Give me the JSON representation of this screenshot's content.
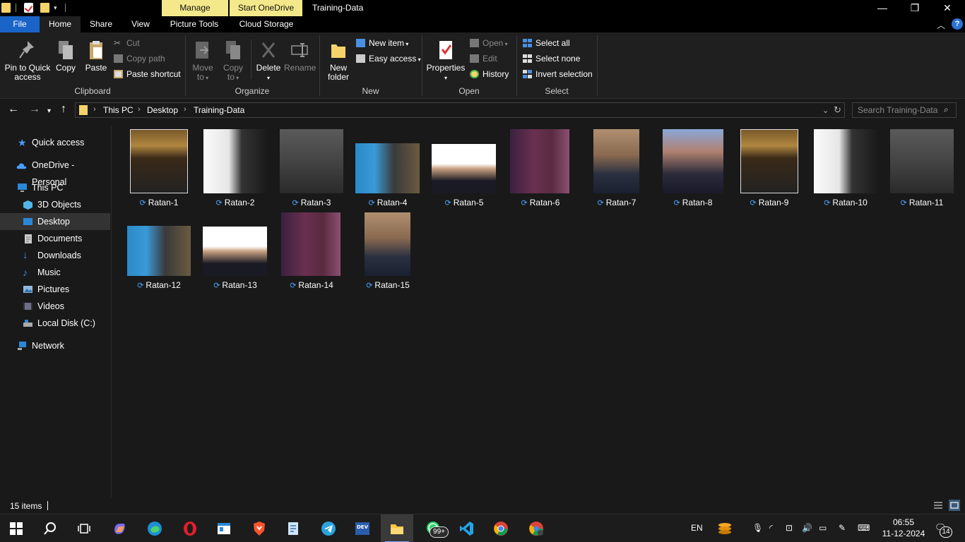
{
  "window": {
    "title": "Training-Data",
    "contextual_tabs": [
      "Manage",
      "Start OneDrive"
    ],
    "controls": {
      "minimize": "—",
      "maximize": "❐",
      "close": "✕"
    }
  },
  "ribbon_tabs": [
    "File",
    "Home",
    "Share",
    "View",
    "Picture Tools",
    "Cloud Storage"
  ],
  "ribbon": {
    "clipboard": {
      "label": "Clipboard",
      "pin": "Pin to Quick access",
      "copy": "Copy",
      "paste": "Paste",
      "cut": "Cut",
      "copy_path": "Copy path",
      "paste_shortcut": "Paste shortcut"
    },
    "organize": {
      "label": "Organize",
      "move_to": "Move to",
      "copy_to": "Copy to",
      "delete": "Delete",
      "rename": "Rename"
    },
    "new": {
      "label": "New",
      "new_folder": "New folder",
      "new_item": "New item",
      "easy_access": "Easy access"
    },
    "open": {
      "label": "Open",
      "properties": "Properties",
      "open": "Open",
      "edit": "Edit",
      "history": "History"
    },
    "select": {
      "label": "Select",
      "select_all": "Select all",
      "select_none": "Select none",
      "invert": "Invert selection"
    }
  },
  "address": {
    "breadcrumbs": [
      "This PC",
      "Desktop",
      "Training-Data"
    ],
    "search_placeholder": "Search Training-Data"
  },
  "nav": {
    "items": [
      {
        "label": "Quick access",
        "icon": "star-icon"
      },
      {
        "label": "OneDrive - Personal",
        "icon": "cloud-icon"
      },
      {
        "label": "This PC",
        "icon": "computer-icon"
      },
      {
        "label": "3D Objects",
        "icon": "cube-icon"
      },
      {
        "label": "Desktop",
        "icon": "desktop-icon"
      },
      {
        "label": "Documents",
        "icon": "document-icon"
      },
      {
        "label": "Downloads",
        "icon": "download-icon"
      },
      {
        "label": "Music",
        "icon": "music-icon"
      },
      {
        "label": "Pictures",
        "icon": "pictures-icon"
      },
      {
        "label": "Videos",
        "icon": "video-icon"
      },
      {
        "label": "Local Disk (C:)",
        "icon": "disk-icon"
      },
      {
        "label": "Network",
        "icon": "network-icon"
      }
    ],
    "selected": "Desktop"
  },
  "files": [
    {
      "name": "Ratan-1"
    },
    {
      "name": "Ratan-2"
    },
    {
      "name": "Ratan-3"
    },
    {
      "name": "Ratan-4"
    },
    {
      "name": "Ratan-5"
    },
    {
      "name": "Ratan-6"
    },
    {
      "name": "Ratan-7"
    },
    {
      "name": "Ratan-8"
    },
    {
      "name": "Ratan-9"
    },
    {
      "name": "Ratan-10"
    },
    {
      "name": "Ratan-11"
    },
    {
      "name": "Ratan-12"
    },
    {
      "name": "Ratan-13"
    },
    {
      "name": "Ratan-14"
    },
    {
      "name": "Ratan-15"
    }
  ],
  "status": {
    "item_count": "15 items"
  },
  "taskbar": {
    "language": "EN",
    "time": "06:55",
    "date": "11-12-2024",
    "whatsapp_badge": "99+",
    "notification_count": "14",
    "apps": [
      "start-icon",
      "search-icon",
      "task-view-icon",
      "copilot-icon",
      "edge-icon",
      "opera-icon",
      "app-icon",
      "brave-icon",
      "notepad-icon",
      "telegram-icon",
      "devhome-icon",
      "file-explorer-icon",
      "whatsapp-icon",
      "vscode-icon",
      "chrome-icon",
      "chrome-profile-icon"
    ]
  }
}
